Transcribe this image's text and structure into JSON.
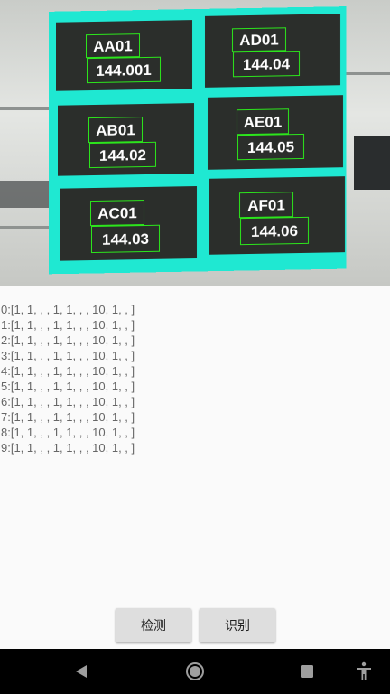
{
  "camera": {
    "cells": [
      {
        "code": "AA01",
        "value": "144.001"
      },
      {
        "code": "AD01",
        "value": "144.04"
      },
      {
        "code": "AB01",
        "value": "144.02"
      },
      {
        "code": "AE01",
        "value": "144.05"
      },
      {
        "code": "AC01",
        "value": "144.03"
      },
      {
        "code": "AF01",
        "value": "144.06"
      }
    ]
  },
  "log": [
    "0:[1, 1, , , 1, 1, , , 10, 1, , ]",
    "1:[1, 1, , , 1, 1, , , 10, 1, , ]",
    "2:[1, 1, , , 1, 1, , , 10, 1, , ]",
    "3:[1, 1, , , 1, 1, , , 10, 1, , ]",
    "4:[1, 1, , , 1, 1, , , 10, 1, , ]",
    "5:[1, 1, , , 1, 1, , , 10, 1, , ]",
    "6:[1, 1, , , 1, 1, , , 10, 1, , ]",
    "7:[1, 1, , , 1, 1, , , 10, 1, , ]",
    "8:[1, 1, , , 1, 1, , , 10, 1, , ]",
    "9:[1, 1, , , 1, 1, , , 10, 1, , ]"
  ],
  "buttons": {
    "detect": "检测",
    "recognize": "识别"
  },
  "navbar": {
    "back_icon": "back-triangle-icon",
    "home_icon": "home-circle-icon",
    "recents_icon": "recents-square-icon",
    "accessibility_icon": "accessibility-icon"
  },
  "colors": {
    "panel_border": "#1fe8d2",
    "detection_box": "#2ce61c",
    "cell_background": "#2b2e2b"
  }
}
